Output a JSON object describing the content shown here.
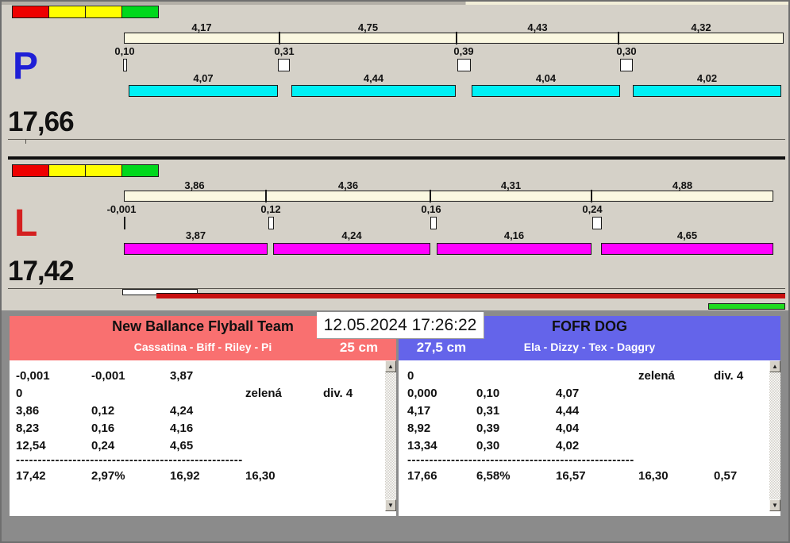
{
  "colors": {
    "window_background": "#d5d1c8",
    "split_bar": "#fbf8e1",
    "lane_p_dog_bar": "#00f0f5",
    "lane_l_dog_bar": "#ff00ff",
    "team_left_header": "#f97070",
    "team_right_header": "#6464ea",
    "progress_red": "#c81010",
    "progress_green": "#1fdb1f",
    "lane_p_letter": "#1f1fd6",
    "lane_l_letter": "#d42020"
  },
  "clock": "12.05.2024 17:26:22",
  "icons": {
    "scroll_up": "▲",
    "scroll_down": "▼"
  },
  "status_lights": [
    "red",
    "yellow",
    "yellow",
    "green"
  ],
  "lane_p": {
    "letter": "P",
    "total": "17,66",
    "segments": [
      "4,17",
      "4,75",
      "4,43",
      "4,32"
    ],
    "changes": [
      "0,10",
      "0,31",
      "0,39",
      "0,30"
    ],
    "dog_times": [
      "4,07",
      "4,44",
      "4,04",
      "4,02"
    ]
  },
  "lane_l": {
    "letter": "L",
    "total": "17,42",
    "segments": [
      "3,86",
      "4,36",
      "4,31",
      "4,88"
    ],
    "changes": [
      "-0,001",
      "0,12",
      "0,16",
      "0,24"
    ],
    "dog_times": [
      "3,87",
      "4,24",
      "4,16",
      "4,65"
    ]
  },
  "team_left": {
    "name": "New Ballance Flyball Team",
    "dogs": "Cassatina - Biff - Riley - Pi",
    "jump_height": "25 cm",
    "rows": [
      [
        "-0,001",
        "-0,001",
        "3,87",
        "",
        ""
      ],
      [
        "0",
        "",
        "",
        "zelená",
        "div. 4"
      ],
      [
        "3,86",
        "0,12",
        "4,24",
        "",
        ""
      ],
      [
        "8,23",
        "0,16",
        "4,16",
        "",
        ""
      ],
      [
        "12,54",
        "0,24",
        "4,65",
        "",
        ""
      ]
    ],
    "separator": "------------------------------------------------------",
    "totals": [
      "17,42",
      "2,97%",
      "16,92",
      "16,30",
      ""
    ]
  },
  "team_right": {
    "name": "FOFR DOG",
    "dogs": "Ela - Dizzy - Tex - Daggry",
    "jump_height": "27,5 cm",
    "rows": [
      [
        "0",
        "",
        "",
        "zelená",
        "div. 4"
      ],
      [
        "0,000",
        "0,10",
        "4,07",
        "",
        ""
      ],
      [
        "4,17",
        "0,31",
        "4,44",
        "",
        ""
      ],
      [
        "8,92",
        "0,39",
        "4,04",
        "",
        ""
      ],
      [
        "13,34",
        "0,30",
        "4,02",
        "",
        ""
      ]
    ],
    "separator": "------------------------------------------------------",
    "totals": [
      "17,66",
      "6,58%",
      "16,57",
      "16,30",
      "0,57"
    ]
  }
}
